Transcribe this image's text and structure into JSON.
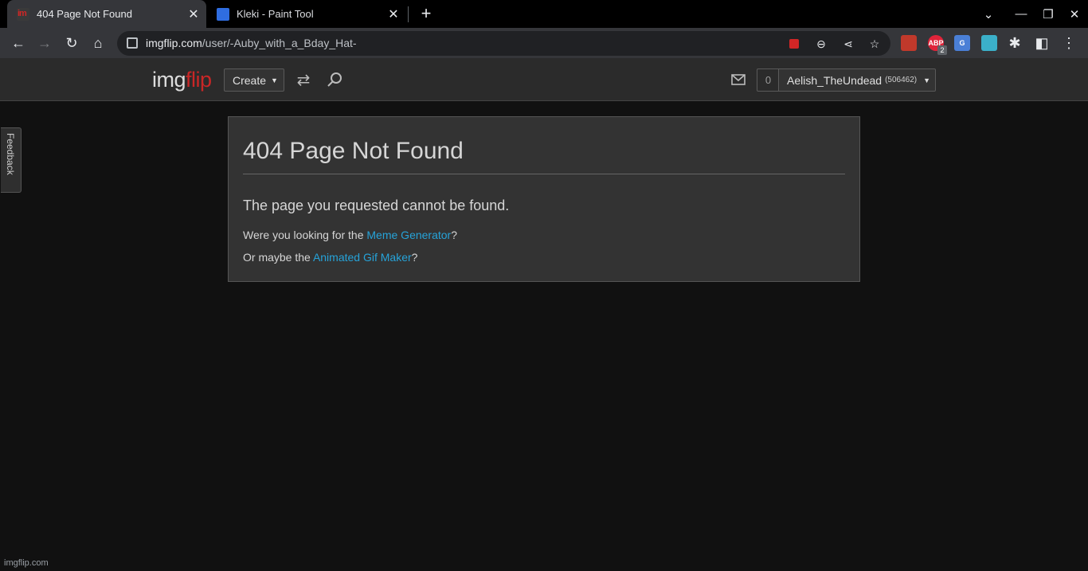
{
  "browser": {
    "tabs": [
      {
        "title": "404 Page Not Found",
        "active": true,
        "favicon": "imgflip-favicon"
      },
      {
        "title": "Kleki - Paint Tool",
        "active": false,
        "favicon": "kleki-favicon"
      }
    ],
    "url_host": "imgflip.com",
    "url_path": "/user/-Auby_with_a_Bday_Hat-",
    "extension_badge": "2",
    "colors": {
      "tabbar": "#000000",
      "toolbar": "#35363a",
      "omnibox": "#202124"
    }
  },
  "site": {
    "logo_img": "img",
    "logo_flip": "flip",
    "create_label": "Create",
    "notification_count": "0",
    "username": "Aelish_TheUndead",
    "user_points": "(506462)",
    "feedback_label": "Feedback",
    "colors": {
      "brand_red": "#c92626",
      "link": "#26a3d9",
      "header_bg": "#2b2b2b",
      "page_bg": "#111111"
    }
  },
  "error": {
    "title": "404 Page Not Found",
    "message": "The page you requested cannot be found.",
    "line1_prefix": "Were you looking for the ",
    "line1_link": "Meme Generator",
    "line1_suffix": "?",
    "line2_prefix": "Or maybe the ",
    "line2_link": "Animated Gif Maker",
    "line2_suffix": "?"
  },
  "status_bar": {
    "url": "imgflip.com"
  }
}
